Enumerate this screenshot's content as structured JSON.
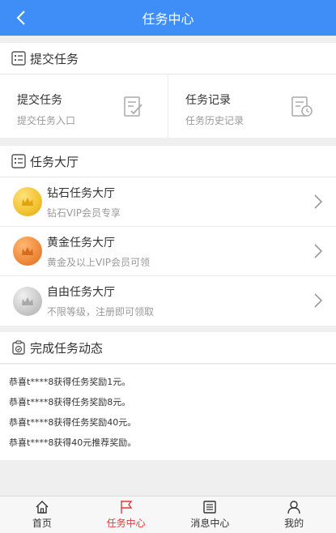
{
  "header": {
    "title": "任务中心",
    "back_icon": "chevron-left-icon"
  },
  "submit_section": {
    "title": "提交任务",
    "icon": "checklist-icon",
    "cells": [
      {
        "title": "提交任务",
        "subtitle": "提交任务入口",
        "icon": "edit-document-icon"
      },
      {
        "title": "任务记录",
        "subtitle": "任务历史记录",
        "icon": "history-document-icon"
      }
    ]
  },
  "hall_section": {
    "title": "任务大厅",
    "icon": "checklist-icon",
    "items": [
      {
        "title": "钻石任务大厅",
        "subtitle": "钻石VIP会员专享",
        "medal": "gold",
        "medal_color": "#f2c230"
      },
      {
        "title": "黄金任务大厅",
        "subtitle": "黄金及以上VIP会员可领",
        "medal": "orange",
        "medal_color": "#ee8a3a"
      },
      {
        "title": "自由任务大厅",
        "subtitle": "不限等级，注册即可领取",
        "medal": "silver",
        "medal_color": "#c8c8c8"
      }
    ]
  },
  "feed_section": {
    "title": "完成任务动态",
    "icon": "clipboard-check-icon",
    "items": [
      "恭喜t****8获得任务奖励1元。",
      "恭喜t****8获得任务奖励8元。",
      "恭喜t****8获得任务奖励40元。",
      "恭喜t****8获得40元推荐奖励。"
    ]
  },
  "tabbar": {
    "tabs": [
      {
        "label": "首页",
        "icon": "home-icon",
        "active": false
      },
      {
        "label": "任务中心",
        "icon": "flag-icon",
        "active": true
      },
      {
        "label": "消息中心",
        "icon": "list-icon",
        "active": false
      },
      {
        "label": "我的",
        "icon": "user-icon",
        "active": false
      }
    ]
  },
  "colors": {
    "primary": "#3f8ef7",
    "active_tab": "#e4393c",
    "background": "#efefef"
  }
}
